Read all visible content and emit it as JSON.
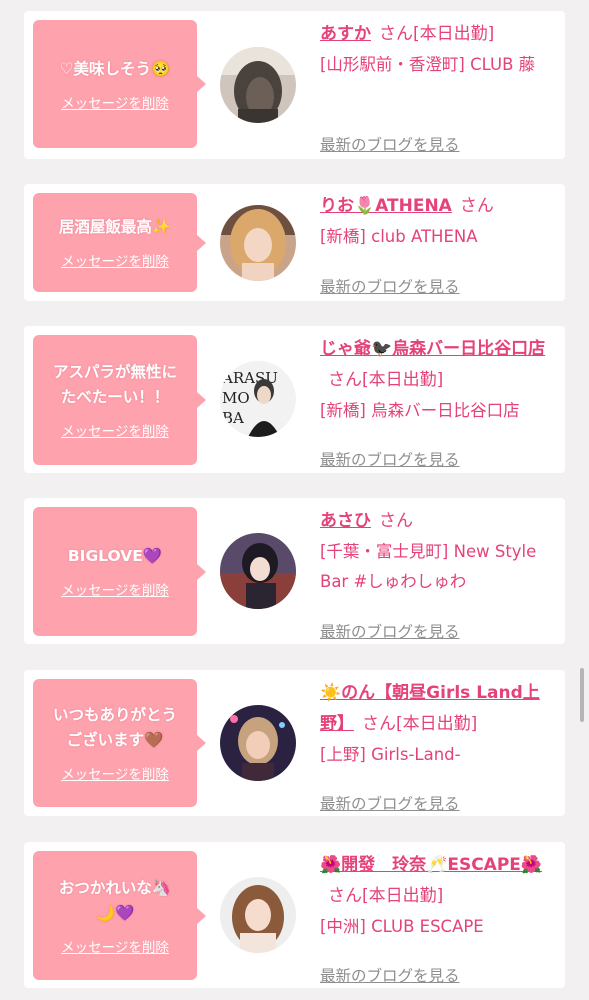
{
  "cards": [
    {
      "message": "♡美味しそう🥺",
      "delete_label": "メッセージを削除",
      "name": "あすか",
      "san": "さん",
      "duty": "[本日出勤]",
      "shop": "[山形駅前・香澄町] CLUB 藤",
      "blog_label": "最新のブログを見る"
    },
    {
      "message": "居酒屋飯最高✨",
      "delete_label": "メッセージを削除",
      "name": "りお🌷ATHENA",
      "san": "さん",
      "duty": "",
      "shop": "[新橋] club ATHENA",
      "blog_label": "最新のブログを見る"
    },
    {
      "message": "アスパラが無性に\nたべたーい！！",
      "delete_label": "メッセージを削除",
      "name": "じゃ爺🐦‍⬛烏森バー日比谷口店",
      "san": "さん",
      "duty": "[本日出勤]",
      "shop": "[新橋] 烏森バー日比谷口店",
      "blog_label": "最新のブログを見る"
    },
    {
      "message": "BIGLOVE💜",
      "delete_label": "メッセージを削除",
      "name": "あさひ",
      "san": "さん",
      "duty": "",
      "shop": "[千葉・富士見町] New Style Bar #しゅわしゅわ",
      "blog_label": "最新のブログを見る"
    },
    {
      "message": "いつもありがとう\nございます🤎",
      "delete_label": "メッセージを削除",
      "name": "☀️のん【朝昼Girls Land上野】",
      "san": "さん",
      "duty": "[本日出勤]",
      "shop": "[上野] Girls-Land-",
      "blog_label": "最新のブログを見る"
    },
    {
      "message": "おつかれいな🦄\n🌙💜",
      "delete_label": "メッセージを削除",
      "name": "🌺開發　玲奈🥂ESCAPE🌺",
      "san": "さん",
      "duty": "[本日出勤]",
      "shop": "[中洲] CLUB ESCAPE",
      "blog_label": "最新のブログを見る"
    }
  ],
  "avatar_text": "ARASU MO BA"
}
